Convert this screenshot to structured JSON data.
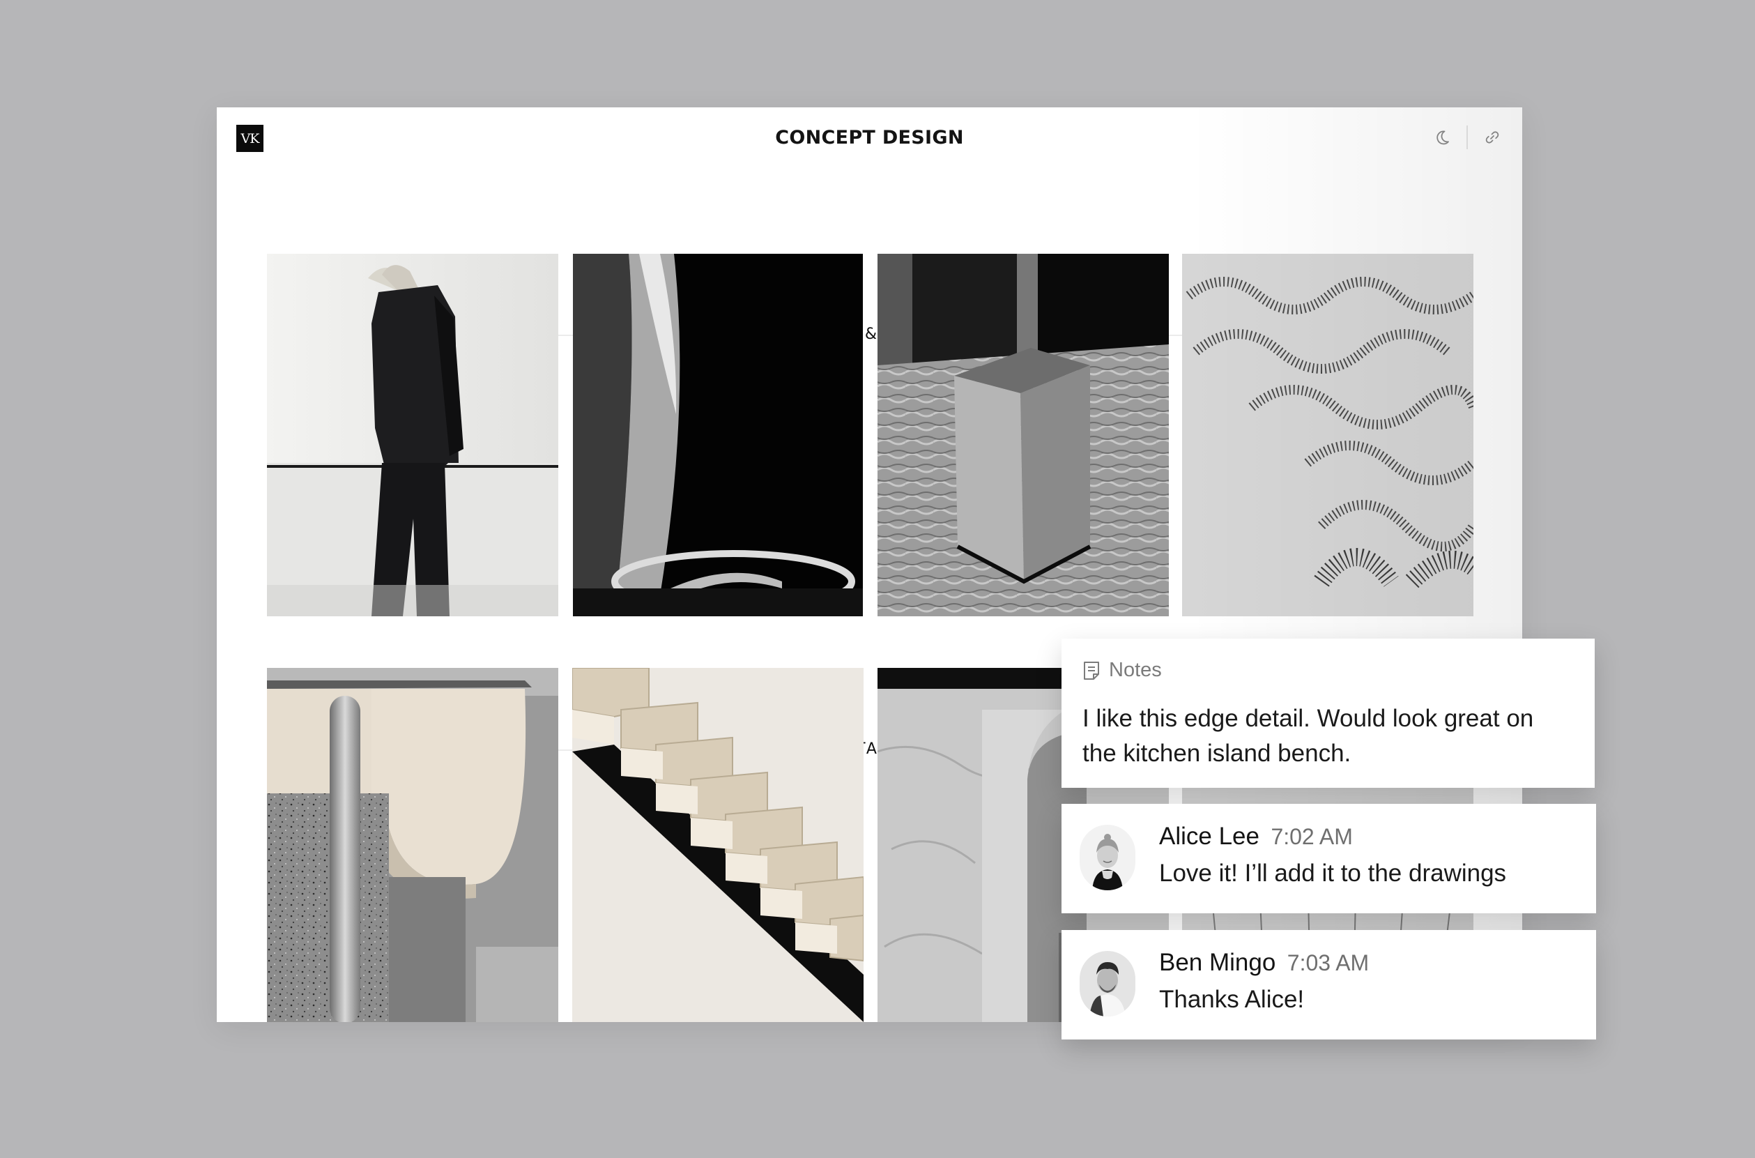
{
  "board": {
    "logo_text": "VK",
    "title": "CONCEPT DESIGN",
    "toolbar": {
      "theme_icon": "moon-icon",
      "share_icon": "link-icon"
    }
  },
  "sections": [
    {
      "label": "LOOK & FEEL"
    },
    {
      "label": "DETAILS"
    }
  ],
  "notes": {
    "header": "Notes",
    "icon": "note-icon",
    "text": "I like this edge detail. Would look great on the kitchen island bench."
  },
  "comments": [
    {
      "author": "Alice Lee",
      "time": "7:02 AM",
      "text": "Love it! I’ll add it to the drawings"
    },
    {
      "author": "Ben Mingo",
      "time": "7:03 AM",
      "text": "Thanks Alice!"
    }
  ],
  "colors": {
    "canvas": "#b6b6b8",
    "board": "#ffffff",
    "ink": "#141414",
    "muted": "#7b7b7b"
  }
}
